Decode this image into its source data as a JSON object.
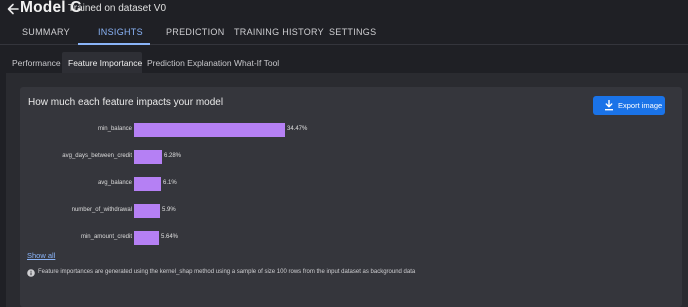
{
  "header": {
    "title": "Model C",
    "subtitle": "Trained on dataset V0"
  },
  "main_tabs": [
    {
      "label": "SUMMARY",
      "active": false
    },
    {
      "label": "INSIGHTS",
      "active": true
    },
    {
      "label": "PREDICTION",
      "active": false
    },
    {
      "label": "TRAINING HISTORY",
      "active": false
    },
    {
      "label": "SETTINGS",
      "active": false
    }
  ],
  "sub_tabs": [
    {
      "label": "Performance",
      "active": false
    },
    {
      "label": "Feature Importance",
      "active": true
    },
    {
      "label": "Prediction Explanation",
      "active": false
    },
    {
      "label": "What-If Tool",
      "active": false
    }
  ],
  "card": {
    "title": "How much each feature impacts your model",
    "export_label": "Export image",
    "show_all": "Show all",
    "footnote": "Feature importances are generated using the kernel_shap method using a sample of size 100 rows from the input dataset as background data"
  },
  "chart_data": {
    "type": "bar",
    "orientation": "horizontal",
    "categories": [
      "min_balance",
      "avg_days_between_credit",
      "avg_balance",
      "number_of_withdrawal",
      "min_amount_credit"
    ],
    "values": [
      34.47,
      6.28,
      6.1,
      5.9,
      5.64
    ],
    "value_labels": [
      "34.47%",
      "6.28%",
      "6.1%",
      "5.9%",
      "5.64%"
    ],
    "bar_color": "#b580f4"
  },
  "colors": {
    "accent": "#8ab4f8",
    "button": "#1a73e8",
    "background": "#1f2025",
    "card": "#35363c"
  }
}
